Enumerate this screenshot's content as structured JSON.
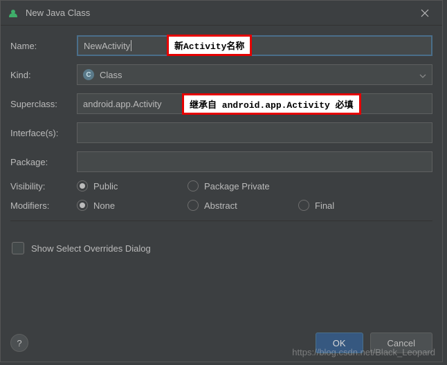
{
  "title": "New Java Class",
  "labels": {
    "name": "Name:",
    "kind": "Kind:",
    "superclass": "Superclass:",
    "interfaces": "Interface(s):",
    "package": "Package:",
    "visibility": "Visibility:",
    "modifiers": "Modifiers:"
  },
  "fields": {
    "name": "NewActivity",
    "kind": "Class",
    "kind_icon_letter": "C",
    "superclass": "android.app.Activity",
    "interfaces": "",
    "package": ""
  },
  "visibility": {
    "public": "Public",
    "package_private": "Package Private",
    "selected": "public"
  },
  "modifiers": {
    "none": "None",
    "abstract": "Abstract",
    "final": "Final",
    "selected": "none"
  },
  "checkbox": {
    "show_overrides": "Show Select Overrides Dialog",
    "checked": false
  },
  "buttons": {
    "ok": "OK",
    "cancel": "Cancel",
    "help": "?"
  },
  "annotations": {
    "name_hint": "新Activity名称",
    "superclass_hint": "继承自 android.app.Activity 必填"
  },
  "watermark": "https://blog.csdn.net/Black_Leopard"
}
